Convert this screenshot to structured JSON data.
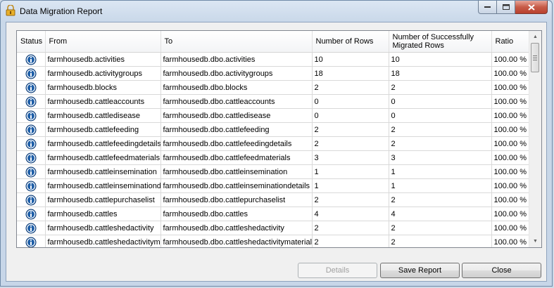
{
  "window": {
    "title": "Data Migration Report"
  },
  "columns": [
    "Status",
    "From",
    "To",
    "Number of Rows",
    "Number of Successfully Migrated Rows",
    "Ratio"
  ],
  "rows": [
    {
      "from": "farmhousedb.activities",
      "to": "farmhousedb.dbo.activities",
      "rows": "10",
      "migrated": "10",
      "ratio": "100.00 %"
    },
    {
      "from": "farmhousedb.activitygroups",
      "to": "farmhousedb.dbo.activitygroups",
      "rows": "18",
      "migrated": "18",
      "ratio": "100.00 %"
    },
    {
      "from": "farmhousedb.blocks",
      "to": "farmhousedb.dbo.blocks",
      "rows": "2",
      "migrated": "2",
      "ratio": "100.00 %"
    },
    {
      "from": "farmhousedb.cattleaccounts",
      "to": "farmhousedb.dbo.cattleaccounts",
      "rows": "0",
      "migrated": "0",
      "ratio": "100.00 %"
    },
    {
      "from": "farmhousedb.cattledisease",
      "to": "farmhousedb.dbo.cattledisease",
      "rows": "0",
      "migrated": "0",
      "ratio": "100.00 %"
    },
    {
      "from": "farmhousedb.cattlefeeding",
      "to": "farmhousedb.dbo.cattlefeeding",
      "rows": "2",
      "migrated": "2",
      "ratio": "100.00 %"
    },
    {
      "from": "farmhousedb.cattlefeedingdetails",
      "to": "farmhousedb.dbo.cattlefeedingdetails",
      "rows": "2",
      "migrated": "2",
      "ratio": "100.00 %"
    },
    {
      "from": "farmhousedb.cattlefeedmaterials",
      "to": "farmhousedb.dbo.cattlefeedmaterials",
      "rows": "3",
      "migrated": "3",
      "ratio": "100.00 %"
    },
    {
      "from": "farmhousedb.cattleinsemination",
      "to": "farmhousedb.dbo.cattleinsemination",
      "rows": "1",
      "migrated": "1",
      "ratio": "100.00 %"
    },
    {
      "from": "farmhousedb.cattleinseminationdeta",
      "to": "farmhousedb.dbo.cattleinseminationdetails",
      "rows": "1",
      "migrated": "1",
      "ratio": "100.00 %"
    },
    {
      "from": "farmhousedb.cattlepurchaselist",
      "to": "farmhousedb.dbo.cattlepurchaselist",
      "rows": "2",
      "migrated": "2",
      "ratio": "100.00 %"
    },
    {
      "from": "farmhousedb.cattles",
      "to": "farmhousedb.dbo.cattles",
      "rows": "4",
      "migrated": "4",
      "ratio": "100.00 %"
    },
    {
      "from": "farmhousedb.cattleshedactivity",
      "to": "farmhousedb.dbo.cattleshedactivity",
      "rows": "2",
      "migrated": "2",
      "ratio": "100.00 %"
    },
    {
      "from": "farmhousedb.cattleshedactivitymate",
      "to": "farmhousedb.dbo.cattleshedactivitymaterials",
      "rows": "2",
      "migrated": "2",
      "ratio": "100.00 %"
    }
  ],
  "buttons": {
    "details": "Details",
    "save": "Save Report",
    "close": "Close"
  },
  "icons": {
    "status": "info-icon",
    "app": "app-icon"
  },
  "colors": {
    "accent": "#1f5fa8",
    "window_frame": "#c9d8e9",
    "close_button": "#c75b48"
  }
}
